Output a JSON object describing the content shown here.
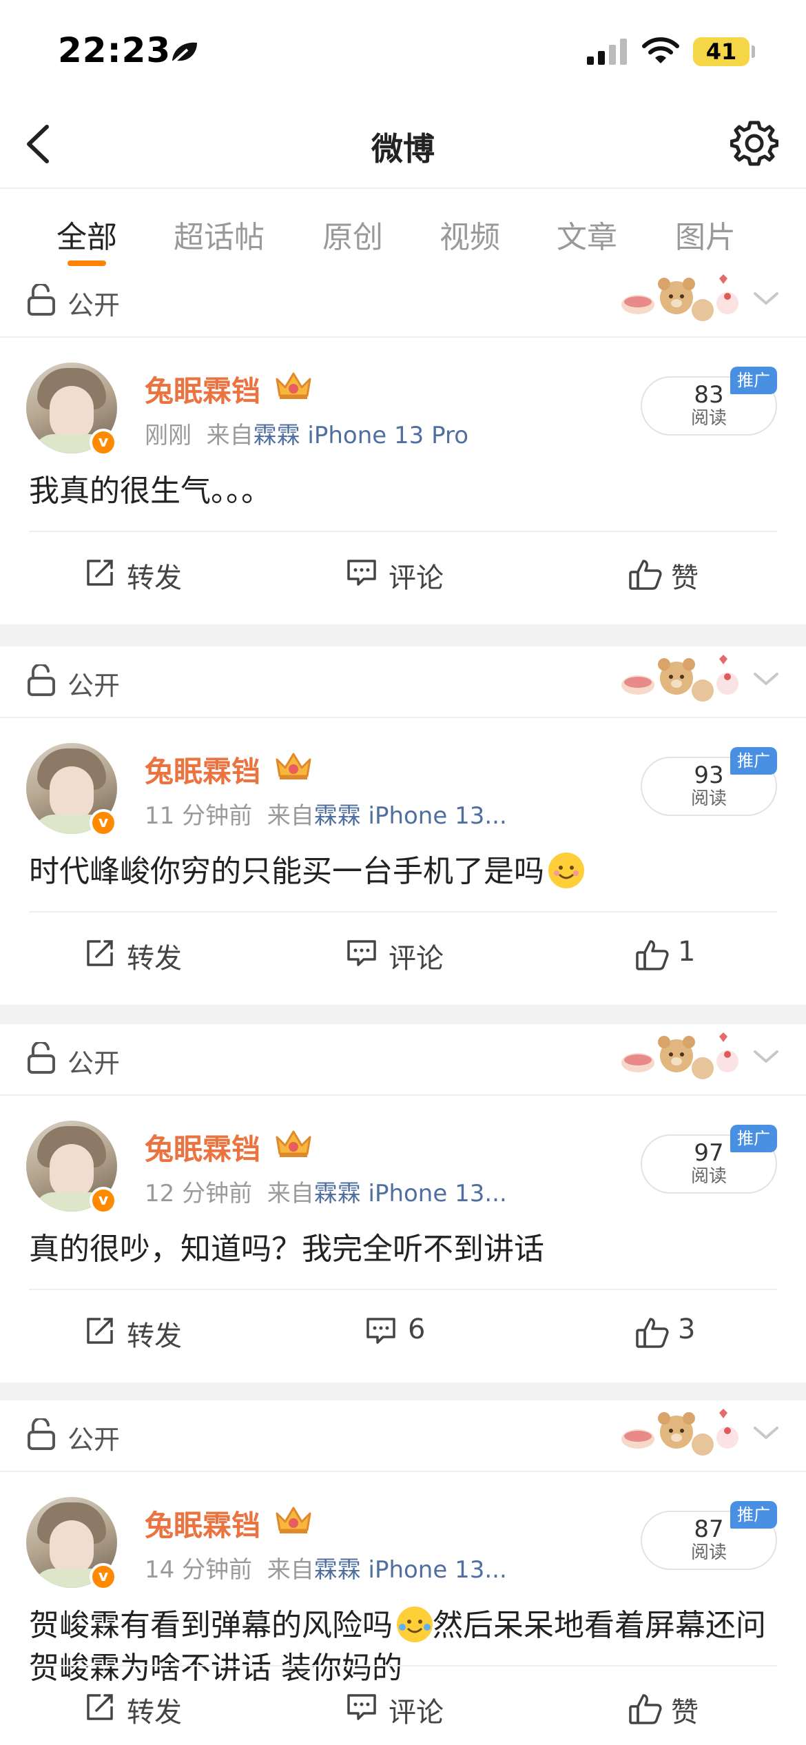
{
  "status_bar": {
    "time": "22:23",
    "battery": "41"
  },
  "nav": {
    "title": "微博"
  },
  "tabs": [
    {
      "label": "全部",
      "active": true
    },
    {
      "label": "超话帖",
      "active": false
    },
    {
      "label": "原创",
      "active": false
    },
    {
      "label": "视频",
      "active": false
    },
    {
      "label": "文章",
      "active": false
    },
    {
      "label": "图片",
      "active": false
    }
  ],
  "posts": [
    {
      "visibility": "公开",
      "username": "兔眠霖铛",
      "time": "刚刚",
      "source_prefix": "来自",
      "source": "霖霖 iPhone 13 Pro",
      "read_count": "83",
      "read_label": "阅读",
      "promo": "推广",
      "text": "我真的很生气。。。",
      "repost": "转发",
      "comment": "评论",
      "like": "赞"
    },
    {
      "visibility": "公开",
      "username": "兔眠霖铛",
      "time": "11 分钟前",
      "source_prefix": "来自",
      "source": "霖霖 iPhone 13...",
      "read_count": "93",
      "read_label": "阅读",
      "promo": "推广",
      "text": "时代峰峻你穷的只能买一台手机了是吗",
      "repost": "转发",
      "comment": "评论",
      "like": "1"
    },
    {
      "visibility": "公开",
      "username": "兔眠霖铛",
      "time": "12 分钟前",
      "source_prefix": "来自",
      "source": "霖霖 iPhone 13...",
      "read_count": "97",
      "read_label": "阅读",
      "promo": "推广",
      "text": "真的很吵，知道吗？我完全听不到讲话",
      "repost": "转发",
      "comment": "6",
      "like": "3"
    },
    {
      "visibility": "公开",
      "username": "兔眠霖铛",
      "time": "14 分钟前",
      "source_prefix": "来自",
      "source": "霖霖 iPhone 13...",
      "read_count": "87",
      "read_label": "阅读",
      "promo": "推广",
      "text": "贺峻霖有看到弹幕的风险吗",
      "text_after": "然后呆呆地看着屏幕还问贺峻霖为啥不讲话 装你妈的",
      "repost": "转发",
      "comment": "评论",
      "like": "赞"
    }
  ]
}
